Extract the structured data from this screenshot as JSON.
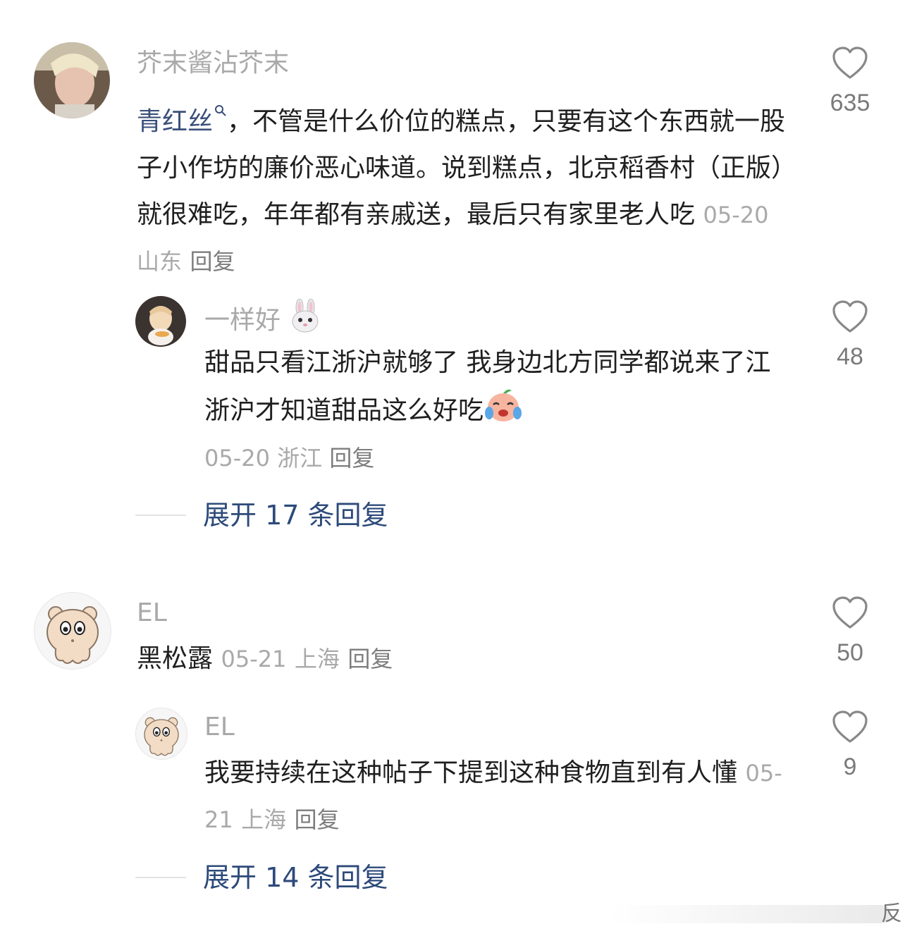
{
  "comments": [
    {
      "username": "芥末酱沾芥末",
      "link_text": "青红丝",
      "text": "，不管是什么价位的糕点，只要有这个东西就一股子小作坊的廉价恶心味道。说到糕点，北京稻香村（正版）就很难吃，年年都有亲戚送，最后只有家里老人吃",
      "date": "05-20",
      "location": "山东",
      "reply_label": "回复",
      "likes": "635",
      "avatar_icon": "user-photo-avatar",
      "replies": [
        {
          "username": "一样好",
          "username_emoji": "rabbit-face-emoji",
          "text": "甜品只看江浙沪就够了 我身边北方同学都说来了江浙沪才知道甜品这么好吃",
          "text_emoji": "crying-laughing-peach-emoji",
          "date": "05-20",
          "location": "浙江",
          "reply_label": "回复",
          "likes": "48",
          "avatar_icon": "girl-with-cake-avatar"
        }
      ],
      "expand_label": "展开 17 条回复"
    },
    {
      "username": "EL",
      "text": "黑松露",
      "date": "05-21",
      "location": "上海",
      "reply_label": "回复",
      "likes": "50",
      "avatar_icon": "bear-cartoon-avatar",
      "replies": [
        {
          "username": "EL",
          "text": "我要持续在这种帖子下提到这种食物直到有人懂",
          "date": "05-21",
          "location": "上海",
          "reply_label": "回复",
          "likes": "9",
          "avatar_icon": "bear-cartoon-avatar"
        }
      ],
      "expand_label": "展开 14 条回复"
    }
  ],
  "watermark_partial": "反",
  "colors": {
    "username": "#a9a9a9",
    "link": "#3a4f7a",
    "expand": "#2d4a7a",
    "meta": "#a9a9a9",
    "text": "#1f1f1f"
  }
}
